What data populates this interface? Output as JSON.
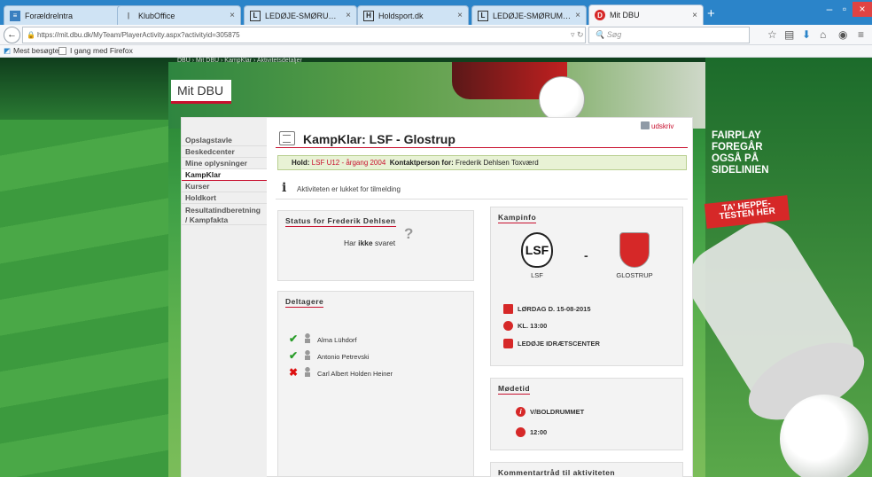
{
  "browser": {
    "tabs": [
      {
        "label": "Forældrelntra",
        "icon": "forum-icon",
        "active": false
      },
      {
        "label": "KlubOffice",
        "icon": "klub-icon",
        "active": false
      },
      {
        "label": "LEDØJE-SMØRUM FODBOLD",
        "icon": "lsf-icon",
        "active": false
      },
      {
        "label": "Holdsport.dk",
        "icon": "holdsport-icon",
        "active": false
      },
      {
        "label": "LEDØJE-SMØRUM FODBOLD",
        "icon": "lsf-icon",
        "active": false
      },
      {
        "label": "Mit DBU",
        "icon": "dbu-icon",
        "active": true
      }
    ],
    "url": "https://mit.dbu.dk/MyTeam/PlayerActivity.aspx?activityid=305875",
    "search_placeholder": "Søg",
    "bookmarks": [
      "Mest besøgte",
      "I gang med Firefox"
    ]
  },
  "page": {
    "breadcrumb": "DBU  ›  Mit DBU  ›  KampKlar  ›  Aktivitetsdetaljer",
    "header": "Mit DBU",
    "print_label": "udskriv",
    "menu": [
      {
        "label": "Opslagstavle",
        "active": false
      },
      {
        "label": "Beskedcenter",
        "active": false
      },
      {
        "label": "Mine oplysninger",
        "active": false
      },
      {
        "label": "KampKlar",
        "active": true
      },
      {
        "label": "Kurser",
        "active": false
      },
      {
        "label": "Holdkort",
        "active": false
      },
      {
        "label": "Resultatindberetning / Kampfakta",
        "active": false
      }
    ],
    "title": "KampKlar: LSF - Glostrup",
    "hold_label": "Hold:",
    "hold_value": "LSF U12 - årgang 2004",
    "contact_label": "Kontaktperson for:",
    "contact_value": "Frederik Dehlsen Toxværd",
    "info_text": "Aktiviteten er lukket for tilmelding",
    "status": {
      "title": "Status for Frederik Dehlsen",
      "text_prefix": "Har",
      "text_bold": "ikke",
      "text_suffix": "svaret"
    },
    "participants": {
      "title": "Deltagere",
      "list": [
        {
          "name": "Alma Lühdorf",
          "status": "yes",
          "mark": "✔"
        },
        {
          "name": "Antonio Petrevski",
          "status": "yes",
          "mark": "✔"
        },
        {
          "name": "Carl Albert Holden Heiner",
          "status": "no",
          "mark": "✖"
        }
      ]
    },
    "match": {
      "title": "Kampinfo",
      "home": "LSF",
      "home_logo_text": "LSF",
      "away": "GLOSTRUP",
      "separator": "-",
      "date": "LØRDAG D. 15-08-2015",
      "time": "KL. 13:00",
      "venue": "LEDØJE IDRÆTSCENTER"
    },
    "meeting": {
      "title": "Mødetid",
      "place": "V/BOLDRUMMET",
      "time": "12:00"
    },
    "comments_title": "Kommentartråd til aktiviteten",
    "ad": {
      "text": "FAIRPLAY FOREGÅR OGSÅ PÅ SIDELINIEN",
      "badge": "TA' HEPPE-TESTEN HER"
    }
  }
}
